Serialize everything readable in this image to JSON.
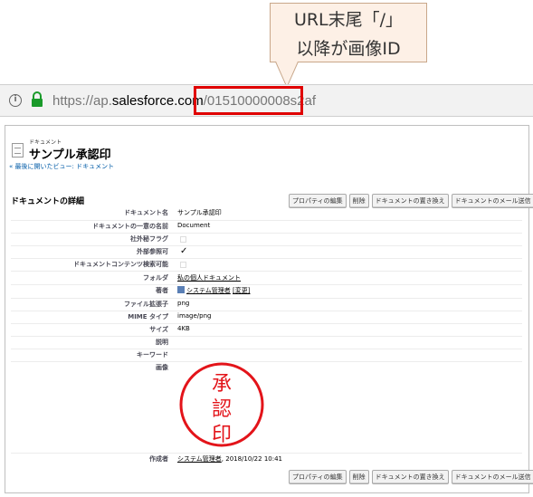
{
  "annotation": {
    "line1": "URL末尾「/」",
    "line2": "以降が画像ID"
  },
  "browser": {
    "url_prefix": "https://ap.",
    "url_host": "salesforce.com",
    "url_path": "/01510000008s2af"
  },
  "header": {
    "entity_type": "ドキュメント",
    "title": "サンプル承認印",
    "back_link": "« 最後に開いたビュー: ドキュメント"
  },
  "detail": {
    "section_title": "ドキュメントの詳細",
    "buttons": [
      "プロパティの編集",
      "削除",
      "ドキュメントの置き換え",
      "ドキュメントのメール送信"
    ],
    "fields": [
      {
        "label": "ドキュメント名",
        "value": "サンプル承認印"
      },
      {
        "label": "ドキュメントの一意の名前",
        "value": "Document"
      },
      {
        "label": "社外秘フラグ",
        "value": ""
      },
      {
        "label": "外部参照可",
        "value": "✓"
      },
      {
        "label": "ドキュメントコンテンツ検索可能",
        "value": ""
      },
      {
        "label": "フォルダ",
        "value": "私の個人ドキュメント"
      },
      {
        "label": "著者",
        "value": "システム管理者",
        "extra": "[変更]"
      },
      {
        "label": "ファイル拡張子",
        "value": "png"
      },
      {
        "label": "MIME タイプ",
        "value": "image/png"
      },
      {
        "label": "サイズ",
        "value": "4KB"
      },
      {
        "label": "説明",
        "value": ""
      },
      {
        "label": "キーワード",
        "value": ""
      },
      {
        "label": "画像",
        "value": ""
      }
    ],
    "stamp_chars": [
      "承",
      "認",
      "印"
    ],
    "created_by_label": "作成者",
    "created_by_user": "システム管理者",
    "created_by_date": ", 2018/10/22 10:41"
  },
  "colors": {
    "highlight": "#e00000",
    "stamp": "#e3141a",
    "link": "#015ba7"
  }
}
